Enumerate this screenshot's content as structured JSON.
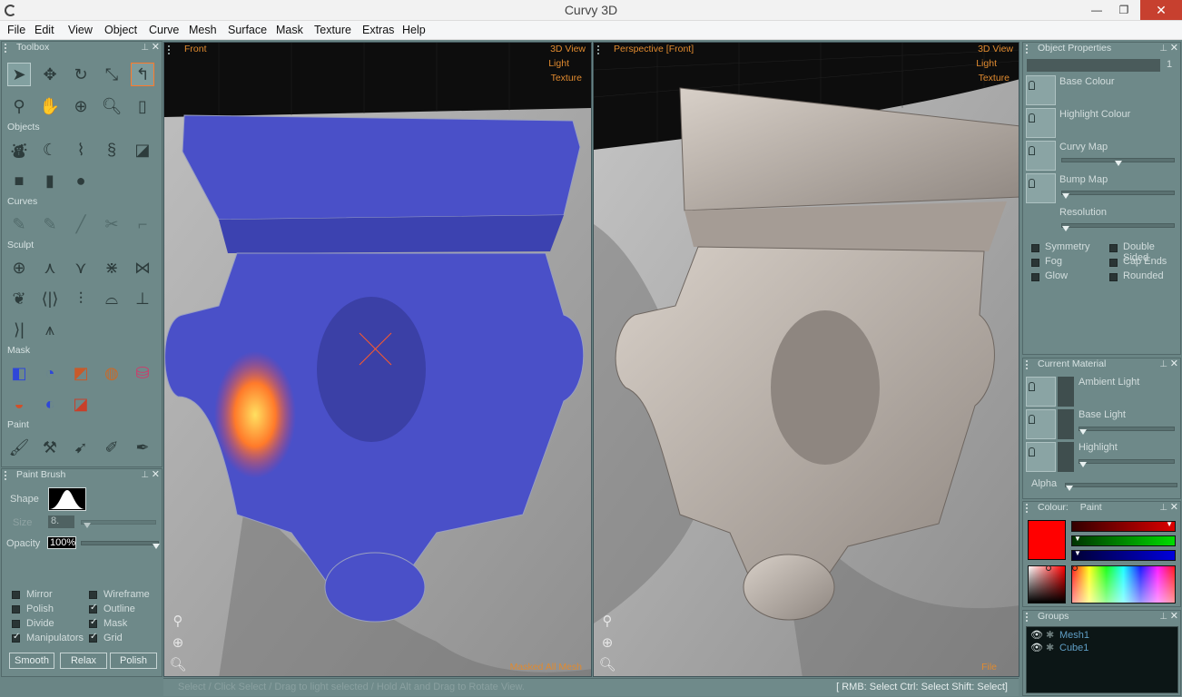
{
  "window": {
    "title": "Curvy 3D",
    "minimize": "—",
    "maximize": "❐",
    "close": "✕"
  },
  "menu": [
    "File",
    "Edit",
    "View",
    "Object",
    "Curve",
    "Mesh",
    "Surface",
    "Mask",
    "Texture",
    "Extras",
    "Help"
  ],
  "toolbox": {
    "title": "Toolbox",
    "sections": {
      "objects": "Objects",
      "curves": "Curves",
      "sculpt": "Sculpt",
      "mask": "Mask",
      "paint": "Paint"
    }
  },
  "brush": {
    "title": "Paint Brush",
    "shape_label": "Shape",
    "size_label": "Size",
    "size_value": "8.",
    "opacity_label": "Opacity",
    "opacity_value": "100%",
    "options": [
      {
        "label": "Mirror",
        "checked": false
      },
      {
        "label": "Wireframe",
        "checked": false
      },
      {
        "label": "Polish",
        "checked": false
      },
      {
        "label": "Outline",
        "checked": true
      },
      {
        "label": "Divide",
        "checked": false
      },
      {
        "label": "Mask",
        "checked": true
      },
      {
        "label": "Manipulators",
        "checked": true
      },
      {
        "label": "Grid",
        "checked": true
      }
    ],
    "buttons": [
      "Smooth",
      "Relax",
      "Polish"
    ]
  },
  "viewport_front": {
    "title": "Front",
    "menu": [
      "3D View",
      "Light",
      "Texture"
    ],
    "footer": "Masked All Mesh"
  },
  "viewport_persp": {
    "title": "Perspective [Front]",
    "menu": [
      "3D View",
      "Light",
      "Texture"
    ],
    "footer": "File"
  },
  "object_properties": {
    "title": "Object Properties",
    "name_value": "",
    "name_suffix": "1",
    "items": [
      "Base Colour",
      "Highlight Colour",
      "Curvy Map",
      "Bump Map"
    ],
    "resolution_label": "Resolution",
    "options": [
      {
        "label": "Symmetry",
        "checked": false
      },
      {
        "label": "Double Sided",
        "checked": false
      },
      {
        "label": "Fog",
        "checked": false
      },
      {
        "label": "Cap Ends",
        "checked": false
      },
      {
        "label": "Glow",
        "checked": false
      },
      {
        "label": "Rounded",
        "checked": false
      }
    ]
  },
  "material": {
    "title": "Current Material",
    "items": [
      "Ambient Light",
      "Base Light",
      "Highlight"
    ],
    "alpha_label": "Alpha"
  },
  "colour": {
    "title": "Colour:",
    "mode": "Paint",
    "swatch": "#ff0000"
  },
  "groups": {
    "title": "Groups",
    "items": [
      {
        "name": "Mesh1"
      },
      {
        "name": "Cube1"
      }
    ]
  },
  "status": {
    "hint": "Select / Click Select / Drag to light selected / Hold Alt and Drag to Rotate View.",
    "keys": "[ RMB: Select   Ctrl: Select   Shift: Select]"
  }
}
